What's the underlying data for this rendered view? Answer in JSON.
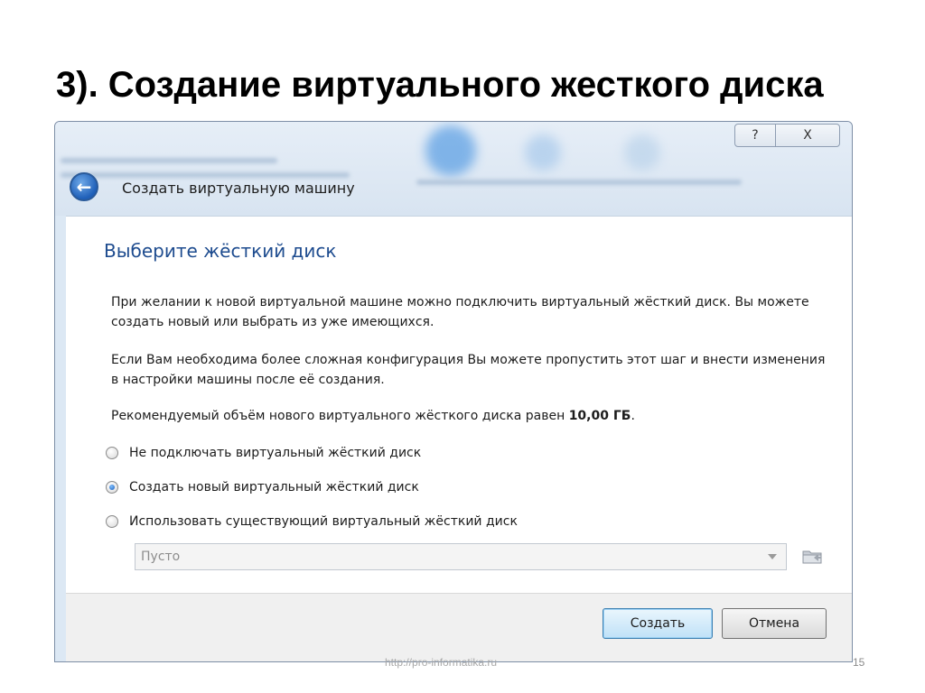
{
  "slide": {
    "title": "3). Создание виртуального жесткого диска",
    "source_url": "http://pro-informatika.ru",
    "page_number": "15"
  },
  "window": {
    "help_label": "?",
    "close_label": "X",
    "wizard_title": "Создать виртуальную машину"
  },
  "page": {
    "heading": "Выберите жёсткий диск",
    "paragraph1": "При желании к новой виртуальной машине можно подключить виртуальный жёсткий диск. Вы можете создать новый или выбрать из уже имеющихся.",
    "paragraph2": "Если Вам необходима более сложная конфигурация Вы можете пропустить этот шаг и внести изменения в настройки машины после её создания.",
    "paragraph3_prefix": "Рекомендуемый объём нового виртуального жёсткого диска равен ",
    "recommended_size": "10,00 ГБ",
    "paragraph3_suffix": "."
  },
  "options": [
    {
      "label": "Не подключать виртуальный жёсткий диск",
      "selected": false
    },
    {
      "label": "Создать новый виртуальный жёсткий диск",
      "selected": true
    },
    {
      "label": "Использовать существующий виртуальный жёсткий диск",
      "selected": false
    }
  ],
  "combo": {
    "value": "Пусто"
  },
  "buttons": {
    "create": "Создать",
    "cancel": "Отмена"
  },
  "icons": {
    "back": "back-arrow-icon",
    "folder": "folder-icon",
    "dropdown": "chevron-down-icon"
  }
}
